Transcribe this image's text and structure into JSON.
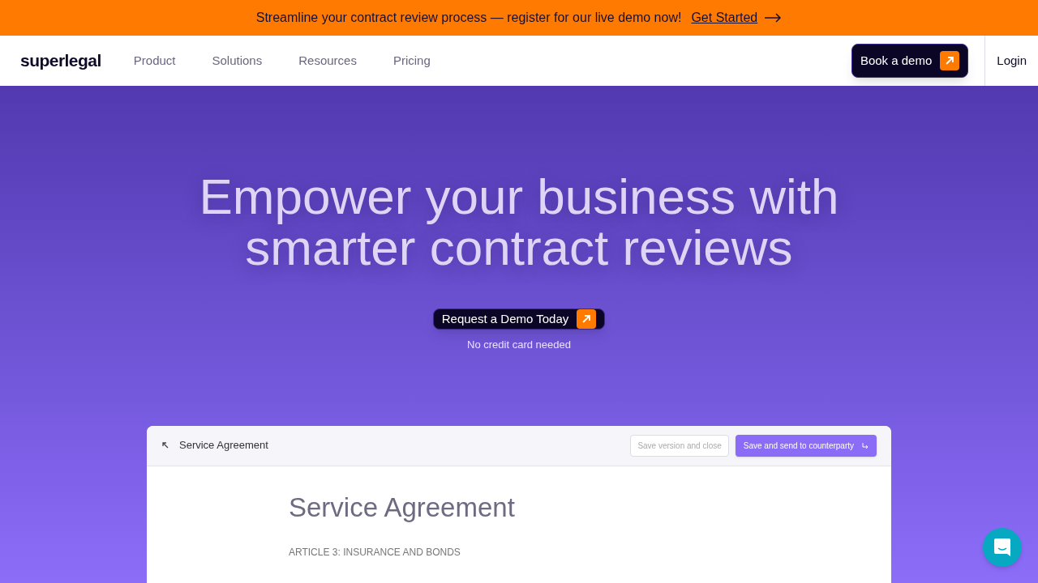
{
  "banner": {
    "text": "Streamline your contract review process — register for our live demo now!",
    "link": "Get Started"
  },
  "nav": {
    "logo": "superlegal",
    "items": [
      "Product",
      "Solutions",
      "Resources",
      "Pricing"
    ],
    "cta": "Book a demo",
    "login": "Login"
  },
  "hero": {
    "title_lines": [
      "Empower your business with",
      "smarter contract reviews"
    ],
    "cta": "Request a Demo Today",
    "note": "No credit card needed"
  },
  "preview": {
    "title": "Service Agreement",
    "secondary_button": "Save version and close",
    "primary_button": "Save and send to counterparty",
    "doc_title": "Service Agreement",
    "doc_heading": "ARTICLE 3: INSURANCE AND BONDS"
  }
}
